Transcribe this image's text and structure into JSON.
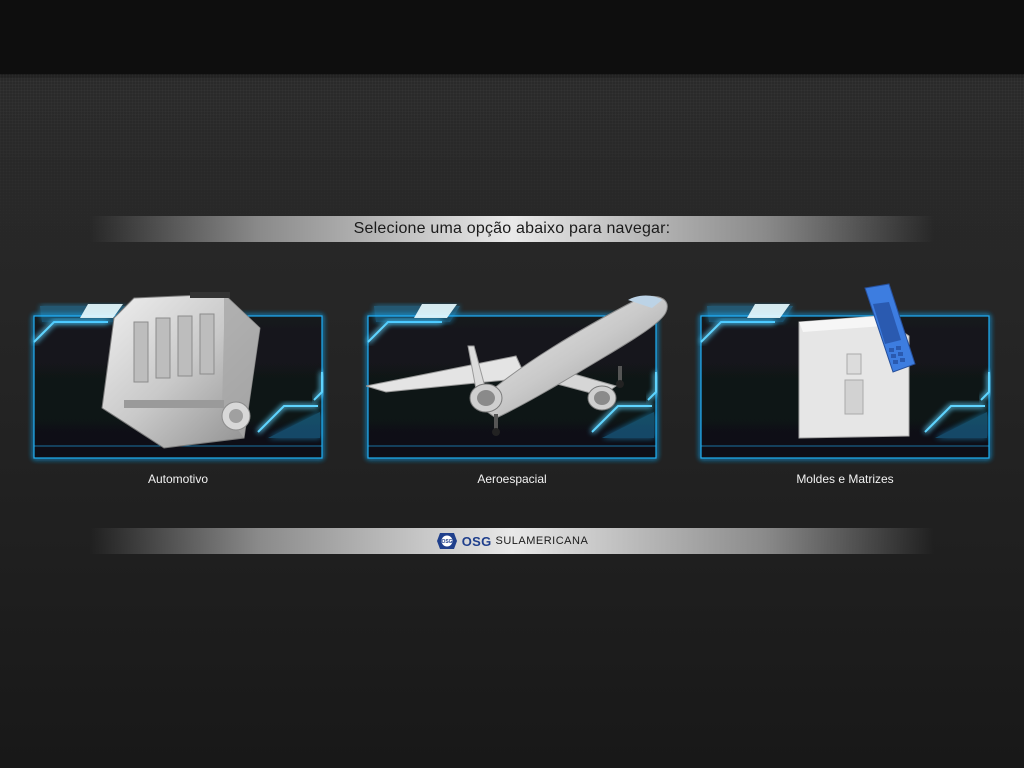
{
  "header": {
    "prompt": "Selecione uma opção abaixo para navegar:"
  },
  "options": [
    {
      "label": "Automotivo",
      "icon": "engine-block-icon"
    },
    {
      "label": "Aeroespacial",
      "icon": "airplane-icon"
    },
    {
      "label": "Moldes e Matrizes",
      "icon": "mold-phone-icon"
    }
  ],
  "footer": {
    "logo_mark": "OSG",
    "brand": "OSG",
    "brand_sub": "SULAMERICANA"
  },
  "colors": {
    "background": "#1d1d1d",
    "frame_glow": "#22b5ff",
    "frame_line": "#5fd4ff",
    "brand_blue": "#1f3f8c",
    "mold_blue": "#3d7de0"
  }
}
